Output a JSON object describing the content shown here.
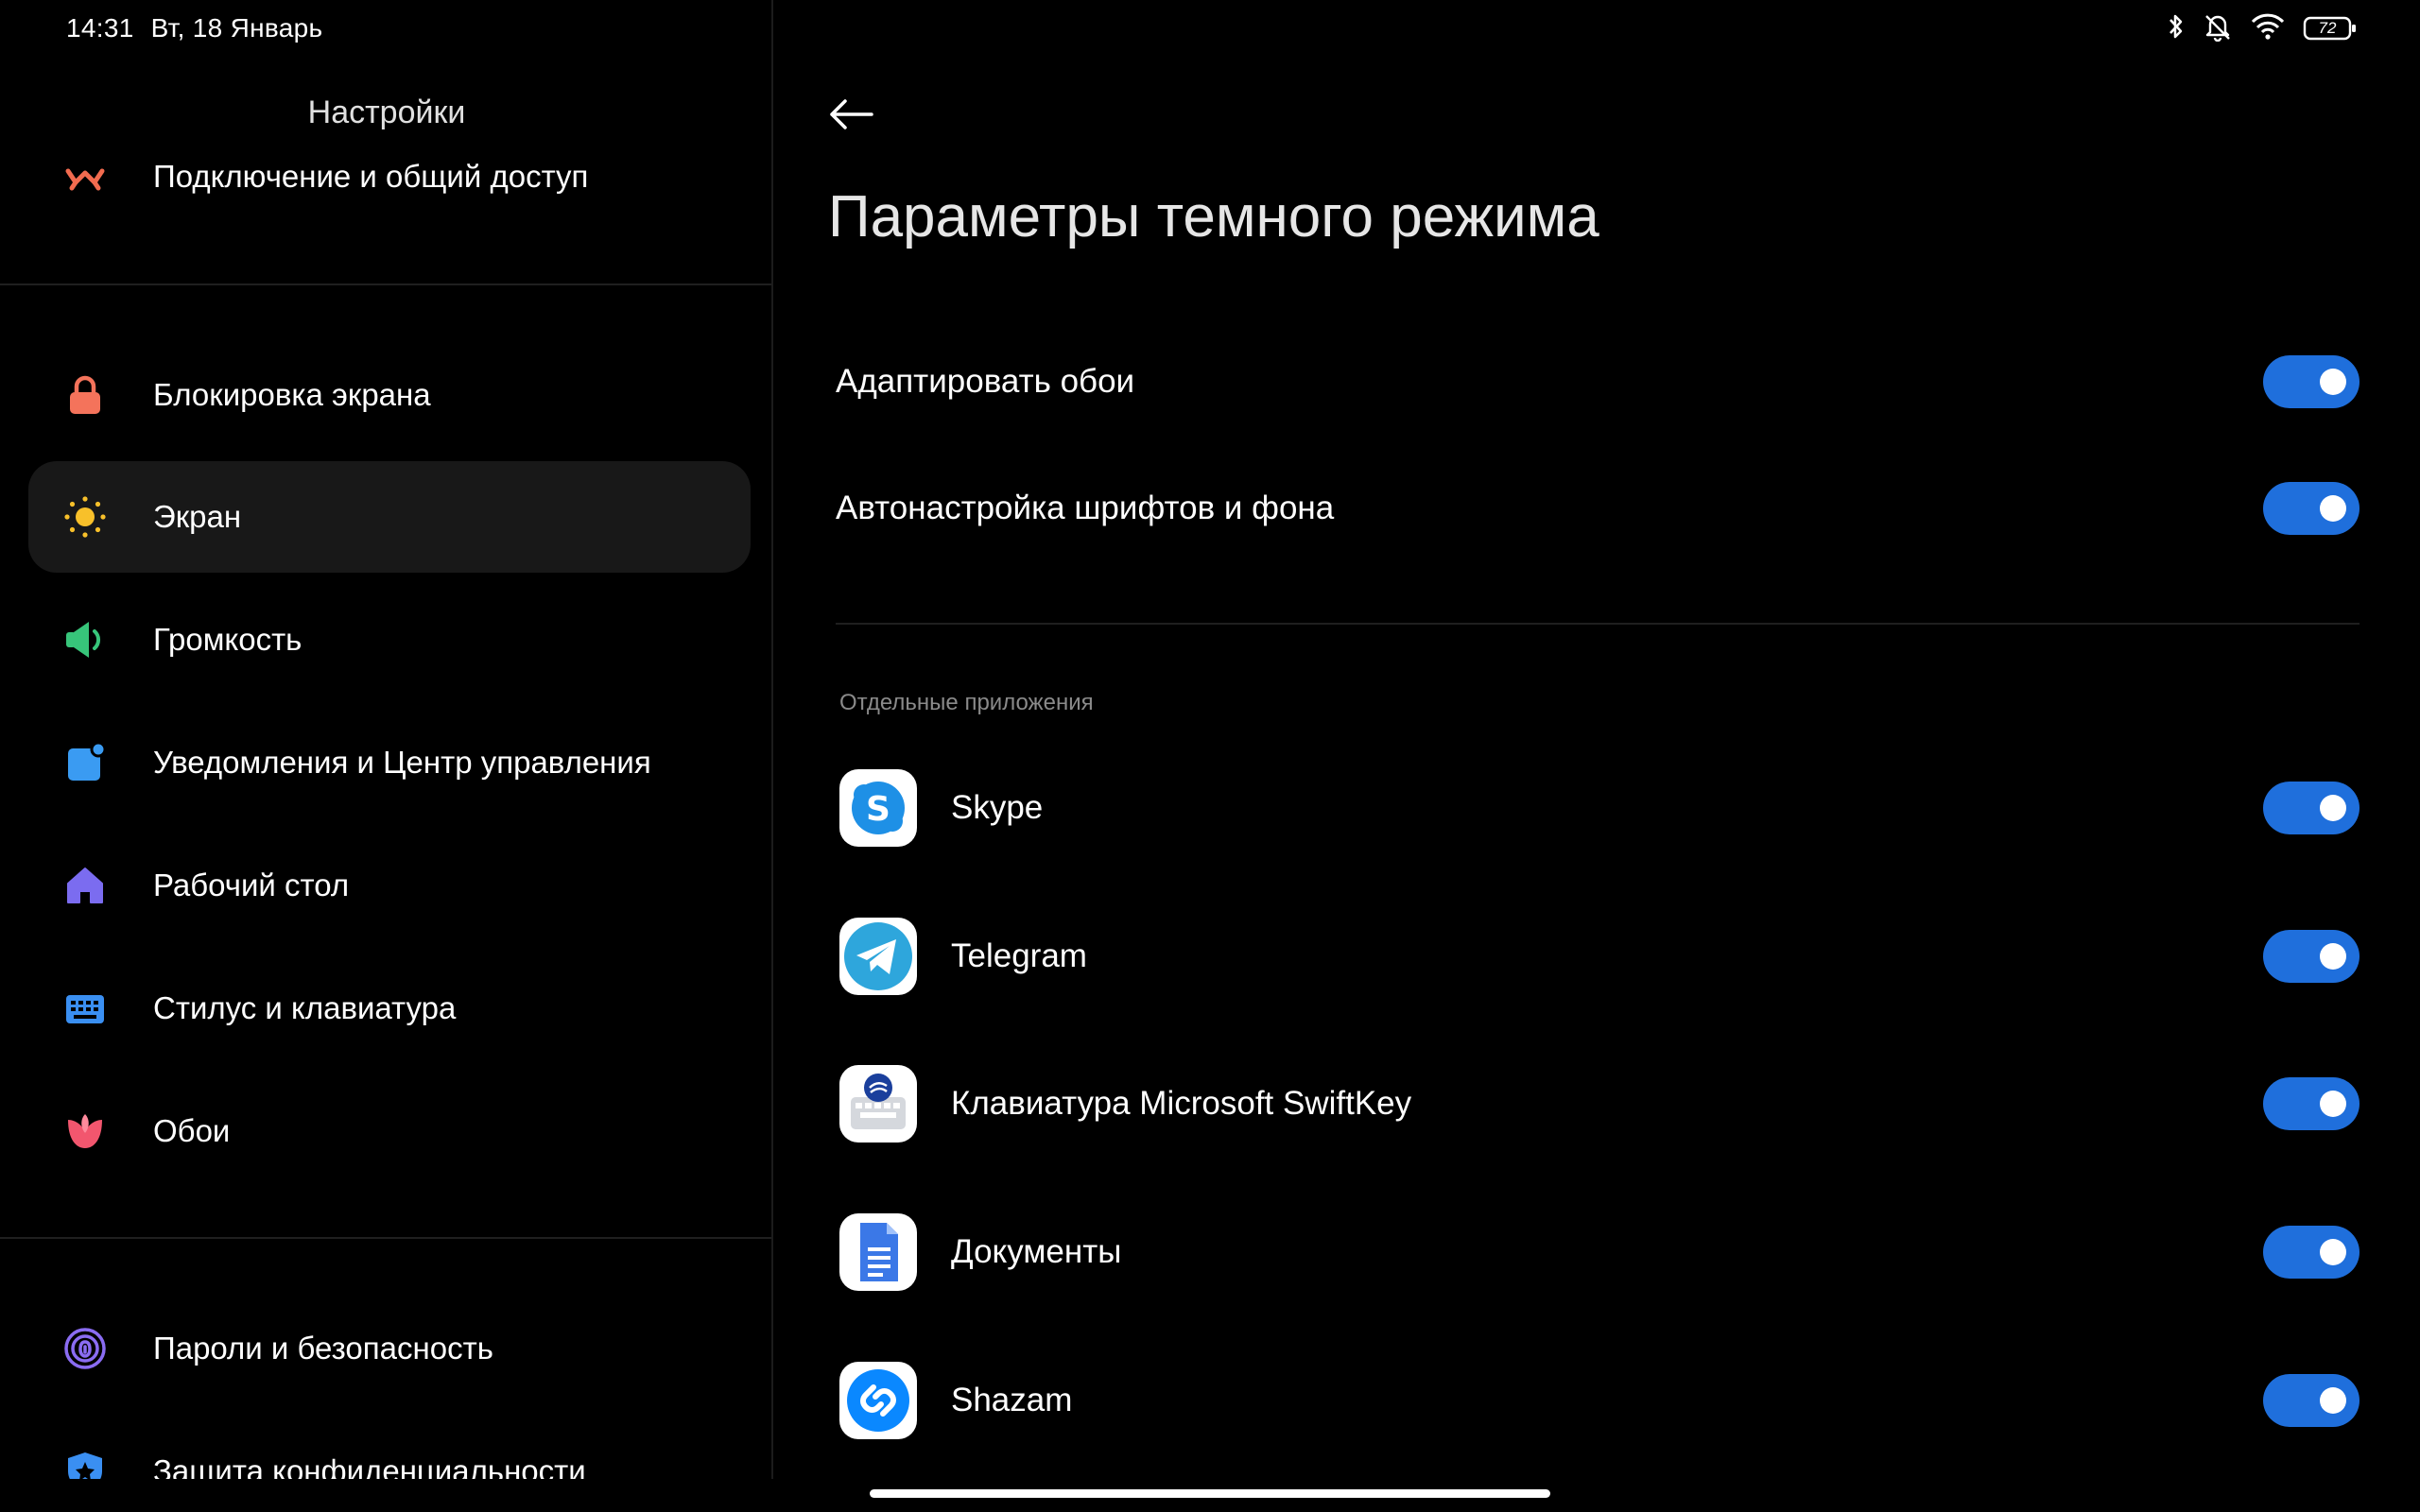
{
  "status_bar": {
    "time": "14:31",
    "date": "Вт, 18 Январь",
    "battery": "72"
  },
  "left_pane": {
    "title": "Настройки",
    "items": [
      {
        "label": "Подключение и общий доступ",
        "icon": "share-icon",
        "color": "#f26b4f"
      },
      {
        "label": "Блокировка экрана",
        "icon": "lock-icon",
        "color": "#f4735b"
      },
      {
        "label": "Экран",
        "icon": "sun-icon",
        "color": "#f8c02a"
      },
      {
        "label": "Громкость",
        "icon": "speaker-icon",
        "color": "#37c57a"
      },
      {
        "label": "Уведомления и Центр управления",
        "icon": "notification-icon",
        "color": "#3a9bf2"
      },
      {
        "label": "Рабочий стол",
        "icon": "home-icon",
        "color": "#7b6cf0"
      },
      {
        "label": "Стилус и клавиатура",
        "icon": "keyboard-icon",
        "color": "#3a8ff2"
      },
      {
        "label": "Обои",
        "icon": "tulip-icon",
        "color": "#f2566e"
      },
      {
        "label": "Пароли и безопасность",
        "icon": "fingerprint-icon",
        "color": "#8a6cf2"
      },
      {
        "label": "Защита конфиденциальности",
        "icon": "shield-icon",
        "color": "#3a8ff2"
      }
    ],
    "active_item": "Экран"
  },
  "main": {
    "title": "Параметры темного режима",
    "settings": [
      {
        "label": "Адаптировать обои",
        "on": true
      },
      {
        "label": "Автонастройка шрифтов и фона",
        "on": true
      }
    ],
    "section_header": "Отдельные приложения",
    "apps": [
      {
        "label": "Skype",
        "icon": "skype-icon",
        "on": true
      },
      {
        "label": "Telegram",
        "icon": "telegram-icon",
        "on": true
      },
      {
        "label": "Клавиатура Microsoft SwiftKey",
        "icon": "swiftkey-icon",
        "on": true
      },
      {
        "label": "Документы",
        "icon": "docs-icon",
        "on": true
      },
      {
        "label": "Shazam",
        "icon": "shazam-icon",
        "on": true
      }
    ]
  },
  "colors": {
    "accent": "#1f6fdc",
    "background": "#000000",
    "active_item_bg": "#181818"
  }
}
